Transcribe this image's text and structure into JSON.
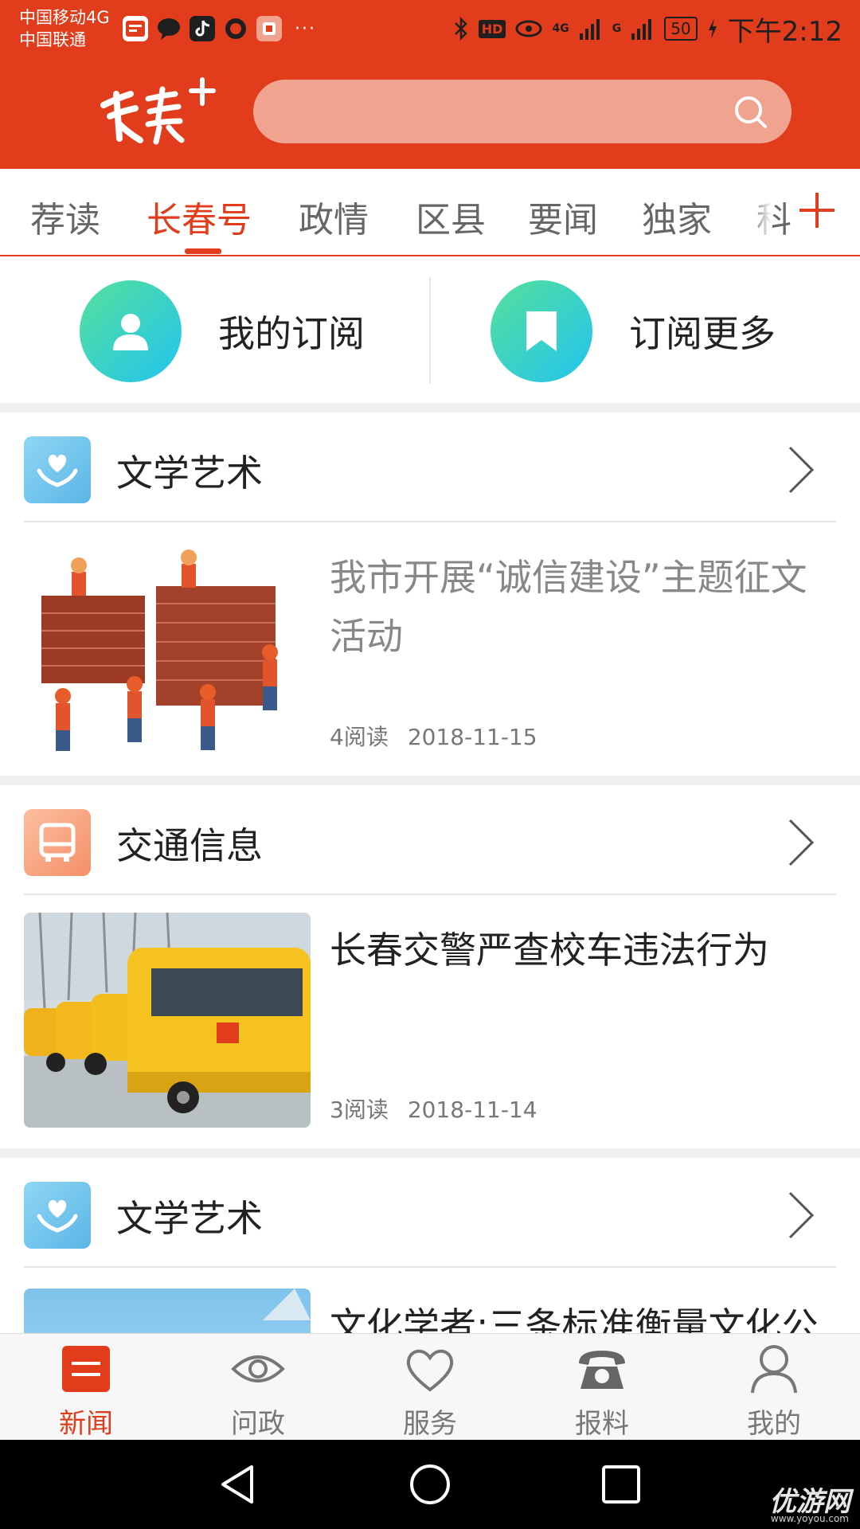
{
  "status_bar": {
    "carrier_1": "中国移动4G",
    "carrier_2": "中国联通",
    "app_icons": [
      "toutiao-icon",
      "message-icon",
      "tiktok-icon",
      "shield-app-icon",
      "store-app-icon"
    ],
    "more": "···",
    "network_1": "4G",
    "network_2": "G",
    "hd": "HD",
    "battery": "50",
    "time": "下午2:12"
  },
  "header": {
    "logo_alt": "长春+",
    "search_placeholder": ""
  },
  "tabs": [
    {
      "label": "荐读",
      "active": false
    },
    {
      "label": "长春号",
      "active": true
    },
    {
      "label": "政情",
      "active": false
    },
    {
      "label": "区县",
      "active": false
    },
    {
      "label": "要闻",
      "active": false
    },
    {
      "label": "独家",
      "active": false
    },
    {
      "label": "科",
      "active": false
    }
  ],
  "subscribe": {
    "my_subscriptions": "我的订阅",
    "more_subscriptions": "订阅更多"
  },
  "sections": [
    {
      "title": "文学艺术",
      "icon": "heart-hands-icon",
      "article": {
        "title": "我市开展“诚信建设”主题征文活动",
        "reads": "4阅读",
        "date": "2018-11-15",
        "image": "integrity-campaign-image"
      }
    },
    {
      "title": "交通信息",
      "icon": "bus-icon",
      "article": {
        "title": "长春交警严查校车违法行为",
        "reads": "3阅读",
        "date": "2018-11-14",
        "image": "school-bus-image"
      }
    },
    {
      "title": "文学艺术",
      "icon": "heart-hands-icon",
      "article": {
        "title": "文化学者:三条标准衡量文化公",
        "image": "sky-image"
      }
    }
  ],
  "bottom_nav": [
    {
      "label": "新闻",
      "icon": "news-icon",
      "active": true
    },
    {
      "label": "问政",
      "icon": "eye-icon",
      "active": false
    },
    {
      "label": "服务",
      "icon": "heart-icon",
      "active": false
    },
    {
      "label": "报料",
      "icon": "telephone-icon",
      "active": false
    },
    {
      "label": "我的",
      "icon": "user-icon",
      "active": false
    }
  ],
  "watermark": {
    "text": "优游网",
    "sub": "www.yoyou.com"
  },
  "colors": {
    "brand": "#e13d1c",
    "search_bg": "#f0a38f",
    "subscribe_gradient_start": "#55e09a",
    "subscribe_gradient_end": "#22c4f0",
    "section_icon_literature": "#6ec3ec",
    "section_icon_traffic": "#f7a07d"
  }
}
